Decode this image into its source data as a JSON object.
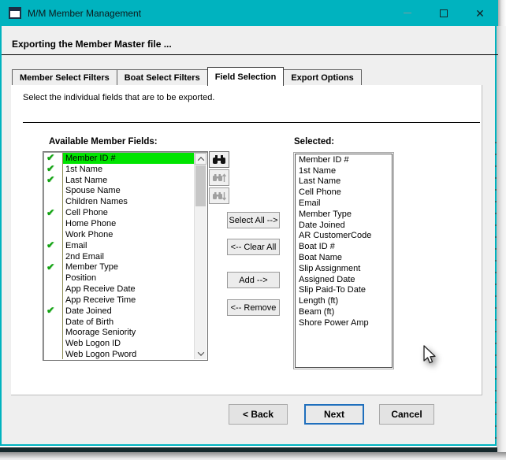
{
  "window": {
    "title": "M/M Member Management",
    "subtitle": "Exporting the Member Master file ..."
  },
  "colors": {
    "titlebar_teal": "#00b3bf",
    "selection_green": "#00e400",
    "check_green": "#12a212",
    "focus_blue": "#1f6fbd"
  },
  "glyphs": {
    "close": "✕",
    "check": "✔"
  },
  "tabs": [
    {
      "label": "Member Select Filters",
      "active": false
    },
    {
      "label": "Boat Select Filters",
      "active": false
    },
    {
      "label": "Field Selection",
      "active": true
    },
    {
      "label": "Export Options",
      "active": false
    }
  ],
  "panel": {
    "instruction": "Select the individual fields that are to be exported."
  },
  "available": {
    "label": "Available Member Fields:",
    "items": [
      {
        "text": "Member ID #",
        "checked": true,
        "highlighted": true
      },
      {
        "text": "1st Name",
        "checked": true,
        "highlighted": false
      },
      {
        "text": "Last Name",
        "checked": true,
        "highlighted": false
      },
      {
        "text": "Spouse Name",
        "checked": false,
        "highlighted": false
      },
      {
        "text": "Children Names",
        "checked": false,
        "highlighted": false
      },
      {
        "text": "Cell Phone",
        "checked": true,
        "highlighted": false
      },
      {
        "text": "Home Phone",
        "checked": false,
        "highlighted": false
      },
      {
        "text": "Work Phone",
        "checked": false,
        "highlighted": false
      },
      {
        "text": "Email",
        "checked": true,
        "highlighted": false
      },
      {
        "text": "2nd Email",
        "checked": false,
        "highlighted": false
      },
      {
        "text": "Member Type",
        "checked": true,
        "highlighted": false
      },
      {
        "text": "Position",
        "checked": false,
        "highlighted": false
      },
      {
        "text": "App Receive Date",
        "checked": false,
        "highlighted": false
      },
      {
        "text": "App Receive Time",
        "checked": false,
        "highlighted": false
      },
      {
        "text": "Date Joined",
        "checked": true,
        "highlighted": false
      },
      {
        "text": "Date of Birth",
        "checked": false,
        "highlighted": false
      },
      {
        "text": "Moorage Seniority",
        "checked": false,
        "highlighted": false
      },
      {
        "text": "Web Logon ID",
        "checked": false,
        "highlighted": false
      },
      {
        "text": "Web Logon Pword",
        "checked": false,
        "highlighted": false
      }
    ]
  },
  "selected": {
    "label": "Selected:",
    "items": [
      "Member ID #",
      "1st Name",
      "Last Name",
      "Cell Phone",
      "Email",
      "Member Type",
      "Date Joined",
      "AR CustomerCode",
      "Boat ID #",
      "Boat Name",
      "Slip Assignment",
      "Assigned Date",
      "Slip Paid-To Date",
      "Length (ft)",
      "Beam (ft)",
      "Shore Power Amp"
    ]
  },
  "find_buttons": [
    {
      "icon": "find-icon",
      "enabled": true
    },
    {
      "icon": "find-previous-icon",
      "enabled": false
    },
    {
      "icon": "find-next-icon",
      "enabled": false
    }
  ],
  "actions": {
    "select_all": "Select All -->",
    "clear_all": "<-- Clear All",
    "add": "Add -->",
    "remove": "<-- Remove"
  },
  "wizard": {
    "back": "< Back",
    "next": "Next",
    "cancel": "Cancel"
  }
}
